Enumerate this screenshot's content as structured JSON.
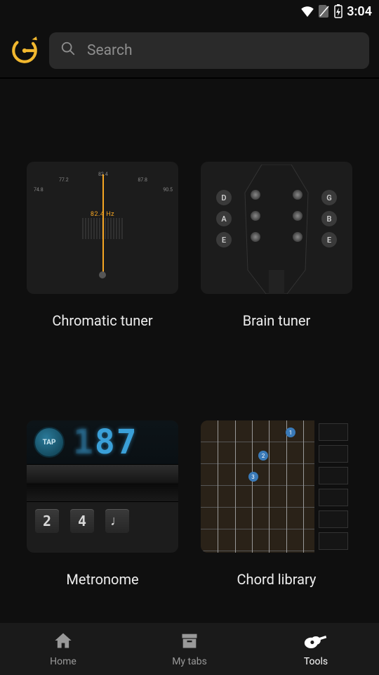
{
  "status": {
    "time": "3:04"
  },
  "search": {
    "placeholder": "Search"
  },
  "tools": [
    {
      "label": "Chromatic tuner",
      "hz_label": "82.4 Hz"
    },
    {
      "label": "Brain tuner",
      "strings_left": [
        "D",
        "A",
        "E"
      ],
      "strings_right": [
        "G",
        "B",
        "E"
      ]
    },
    {
      "label": "Metronome",
      "tap_label": "TAP",
      "bpm": "87",
      "sig_top": "2",
      "sig_bottom": "4",
      "note": "♩"
    },
    {
      "label": "Chord library",
      "fingers": [
        "1",
        "2",
        "3"
      ]
    }
  ],
  "nav": {
    "home": "Home",
    "mytabs": "My tabs",
    "tools": "Tools"
  }
}
